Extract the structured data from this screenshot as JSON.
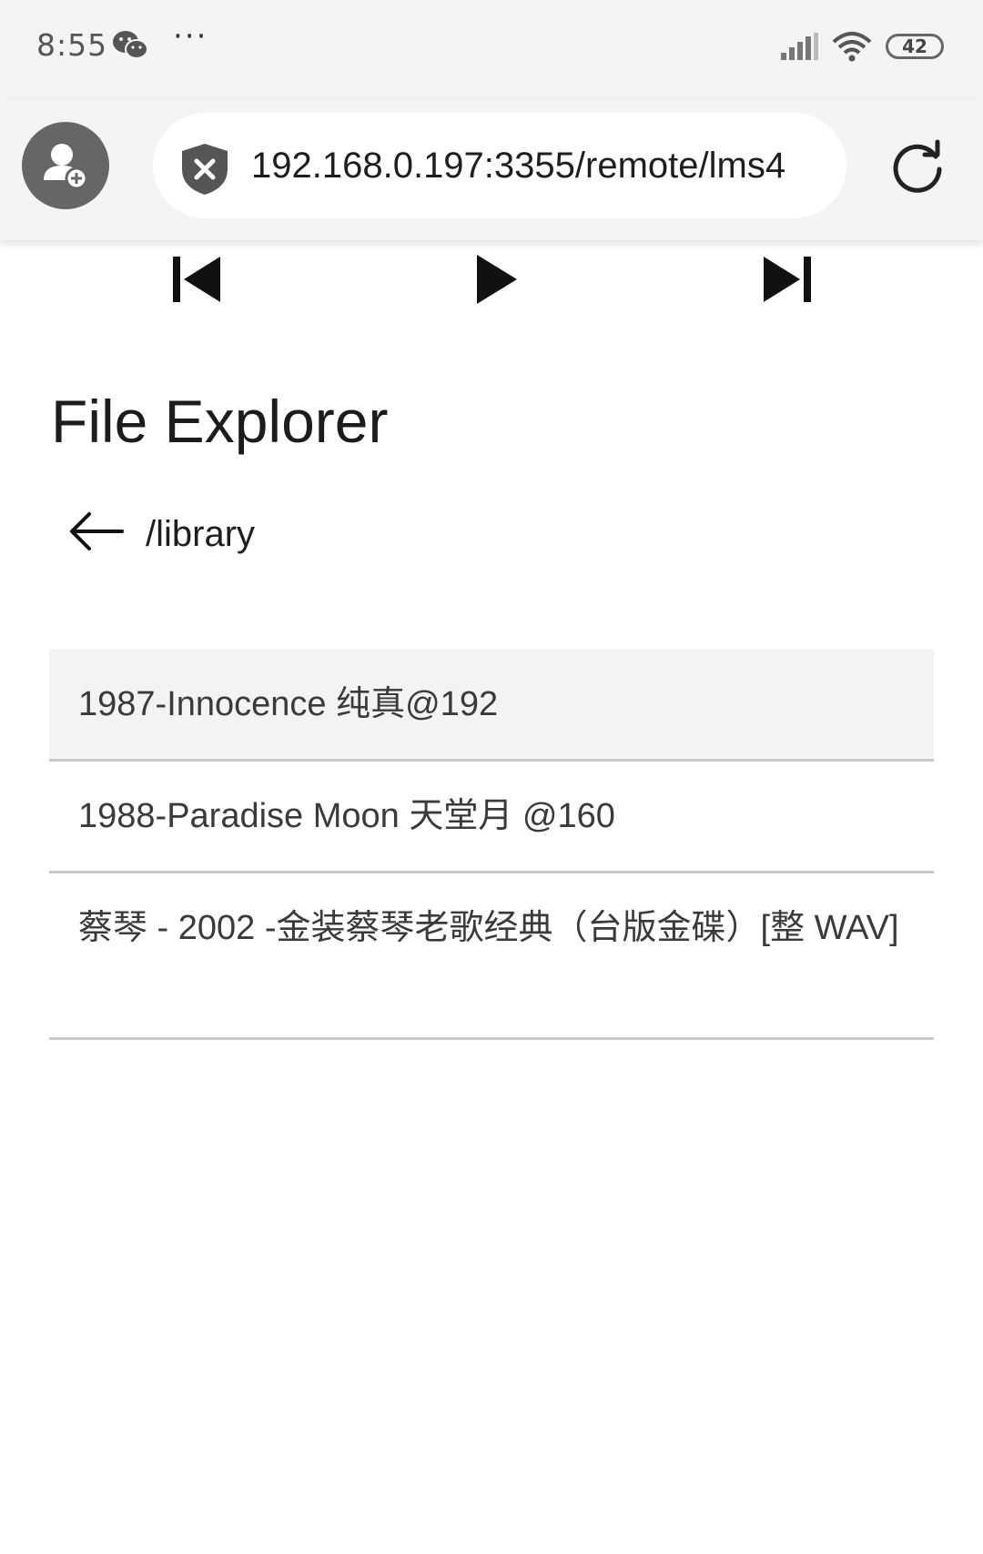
{
  "status_bar": {
    "time": "8:55",
    "dots": "···",
    "battery": "42",
    "icons": [
      "wechat-icon",
      "signal-icon",
      "wifi-icon",
      "battery-icon"
    ]
  },
  "browser": {
    "url": "192.168.0.197:3355/remote/lms4",
    "icons": [
      "add-user-icon",
      "shield-x-icon",
      "reload-icon"
    ]
  },
  "player": {
    "icons": [
      "skip-previous-icon",
      "play-icon",
      "skip-next-icon"
    ]
  },
  "explorer": {
    "title": "File Explorer",
    "path": "/library",
    "items": [
      {
        "label": "1987-Innocence 纯真@192",
        "selected": true
      },
      {
        "label": "1988-Paradise Moon 天堂月 @160",
        "selected": false
      },
      {
        "label": "蔡琴 - 2002 -金装蔡琴老歌经典（台版金碟）[整 WAV]",
        "selected": false
      }
    ]
  }
}
